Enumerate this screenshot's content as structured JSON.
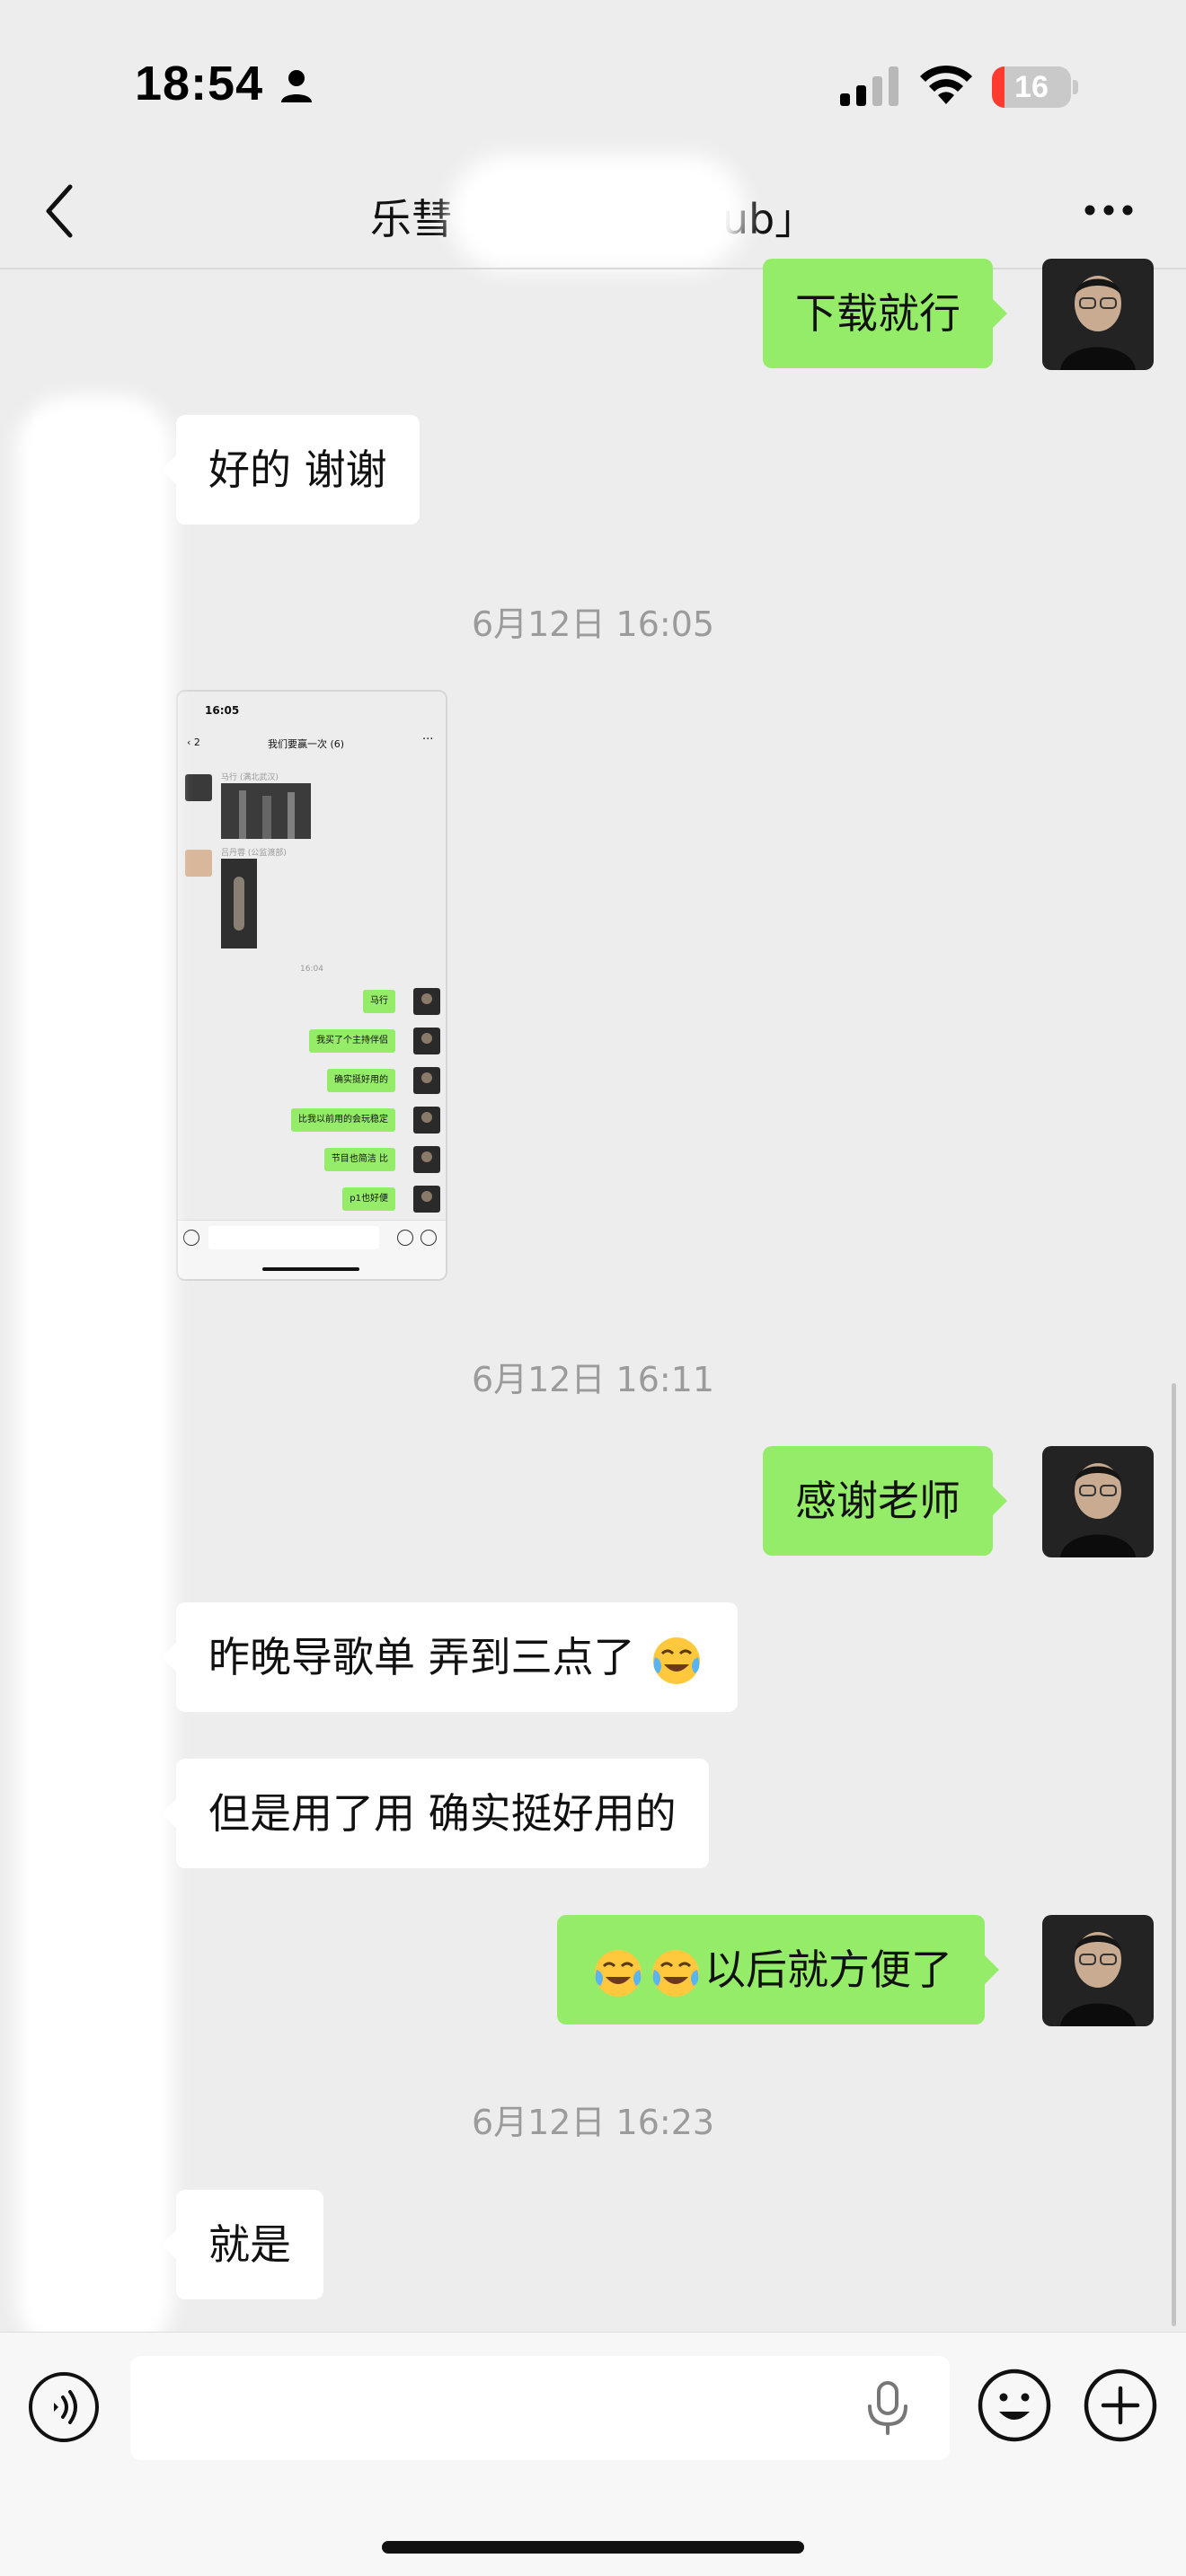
{
  "status_bar": {
    "time": "18:54",
    "battery_level": "16",
    "battery_fraction": 0.16,
    "icons": [
      "person-icon",
      "signal-icon",
      "wifi-icon",
      "battery-icon"
    ]
  },
  "nav": {
    "back_icon": "chevron-left-icon",
    "title_prefix": "乐彗",
    "title_suffix": "ub」",
    "more_icon": "ellipsis-icon"
  },
  "messages": {
    "m1": "下载就行",
    "m2": "好的 谢谢",
    "t1": "6月12日 16:05",
    "t2": "6月12日 16:11",
    "m4": "感谢老师",
    "m5": "昨晚导歌单 弄到三点了",
    "m6": "但是用了用 确实挺好用的",
    "m7": "以后就方便了",
    "t3": "6月12日 16:23",
    "m8": "就是",
    "emoji": "tears-of-joy-emoji"
  },
  "shot": {
    "time": "16:05",
    "unread": "2",
    "title": "我们要赢一次 (6)",
    "sender1": "马行 (满北武汉)",
    "sender2": "吕丹蓉 (公监渡部)",
    "time_mid": "16:04",
    "bubbles": [
      "马行",
      "我买了个主持伴侣",
      "确实挺好用的",
      "比我以前用的会玩稳定",
      "节目也简洁 比",
      "p1也好便"
    ]
  },
  "input": {
    "placeholder": "",
    "icons": [
      "voice-wave-icon",
      "microphone-icon",
      "smiley-icon",
      "plus-icon"
    ]
  },
  "colors": {
    "background": "#ededed",
    "outgoing_bubble": "#95ec69",
    "incoming_bubble": "#ffffff",
    "timestamp": "#9b9b9b",
    "battery_low": "#ff3b30"
  }
}
